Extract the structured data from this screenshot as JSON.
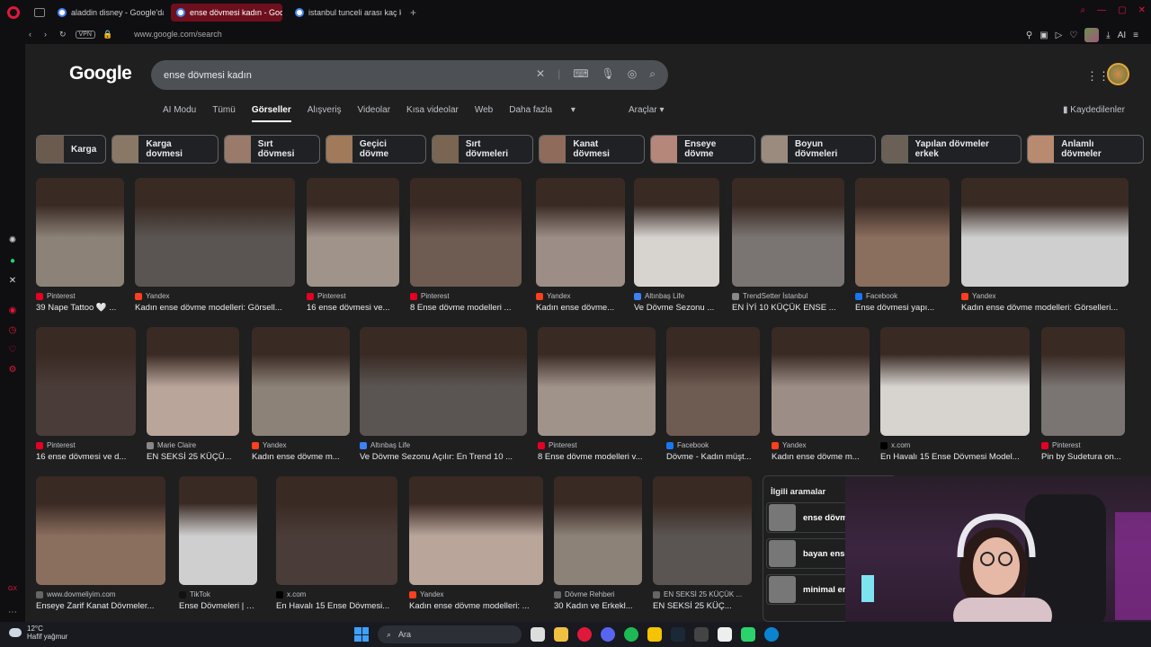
{
  "browser": {
    "tabs": [
      {
        "label": "aladdin disney - Google'da",
        "active": false
      },
      {
        "label": "ense dövmesi kadın - Goo",
        "active": true
      },
      {
        "label": "istanbul tunceli arası kaç k",
        "active": false
      }
    ],
    "new_tab_label": "+",
    "vpn_label": "VPN",
    "url": "www.google.com/search",
    "ai_label": "AI"
  },
  "google": {
    "logo": "Google",
    "query": "ense dövmesi kadın",
    "tabs": [
      "AI Modu",
      "Tümü",
      "Görseller",
      "Alışveriş",
      "Videolar",
      "Kısa videolar",
      "Web",
      "Daha fazla"
    ],
    "selected_tab": "Görseller",
    "tools_label": "Araçlar",
    "saved_label": "Kaydedilenler"
  },
  "chips": [
    "Karga",
    "Karga dovmesi",
    "Sırt dövmesi",
    "Geçici dövme",
    "Sırt dövmeleri",
    "Kanat dövmesi",
    "Enseye dövme",
    "Boyun dövmeleri",
    "Yapılan dövmeler erkek",
    "Anlamlı dövmeler"
  ],
  "results_row1": [
    {
      "source": "Pinterest",
      "title": "39 Nape Tattoo 🤍 ...",
      "src_color": "#e60023"
    },
    {
      "source": "Yandex",
      "title": "Kadın ense dövme modelleri: Görsell...",
      "src_color": "#fc3f1d"
    },
    {
      "source": "Pinterest",
      "title": "16 ense dövmesi ve...",
      "src_color": "#e60023"
    },
    {
      "source": "Pinterest",
      "title": "8 Ense dövme modelleri ...",
      "src_color": "#e60023"
    },
    {
      "source": "Yandex",
      "title": "Kadın ense dövme...",
      "src_color": "#fc3f1d"
    },
    {
      "source": "Altınbaş Life",
      "title": "Ve Dövme Sezonu ...",
      "src_color": "#3b82f6"
    },
    {
      "source": "TrendSetter İstanbul",
      "title": "EN İYİ 10 KÜÇÜK ENSE ...",
      "src_color": "#888888"
    },
    {
      "source": "Facebook",
      "title": "Ense dövmesi yapı...",
      "src_color": "#1877f2"
    },
    {
      "source": "Yandex",
      "title": "Kadın ense dövme modelleri: Görselleri...",
      "src_color": "#fc3f1d"
    }
  ],
  "results_row2": [
    {
      "source": "Pinterest",
      "title": "16 ense dövmesi ve d...",
      "src_color": "#e60023"
    },
    {
      "source": "Marie Claire",
      "title": "EN SEKSİ 25 KÜÇÜ...",
      "src_color": "#888888"
    },
    {
      "source": "Yandex",
      "title": "Kadın ense dövme m...",
      "src_color": "#fc3f1d"
    },
    {
      "source": "Altınbaş Life",
      "title": "Ve Dövme Sezonu Açılır: En Trend 10 ...",
      "src_color": "#3b82f6"
    },
    {
      "source": "Pinterest",
      "title": "8 Ense dövme modelleri v...",
      "src_color": "#e60023"
    },
    {
      "source": "Facebook",
      "title": "Dövme - Kadın müşt...",
      "src_color": "#1877f2"
    },
    {
      "source": "Yandex",
      "title": "Kadın ense dövme m...",
      "src_color": "#fc3f1d"
    },
    {
      "source": "x.com",
      "title": "En Havalı 15 Ense Dövmesi Model...",
      "src_color": "#000000"
    },
    {
      "source": "Pinterest",
      "title": "Pin by Sudetura on...",
      "src_color": "#e60023"
    }
  ],
  "results_row3": [
    {
      "source": "www.dovmeliyim.com",
      "title": "Enseye Zarif Kanat Dövmeler...",
      "src_color": "#666666"
    },
    {
      "source": "TikTok",
      "title": "Ense Dövmeleri | T...",
      "src_color": "#111111"
    },
    {
      "source": "x.com",
      "title": "En Havalı 15 Ense Dövmesi...",
      "src_color": "#000000"
    },
    {
      "source": "Yandex",
      "title": "Kadın ense dövme modelleri: ...",
      "src_color": "#fc3f1d"
    },
    {
      "source": "Dövme Rehberi",
      "title": "30 Kadın ve Erkekl...",
      "src_color": "#666666"
    },
    {
      "source": "EN SEKSİ 25 KÜÇÜK ...",
      "title": "EN SEKSİ 25 KÜÇ...",
      "src_color": "#666666"
    }
  ],
  "related": {
    "title": "İlgili aramalar",
    "items": [
      "ense dövme",
      "bayan ense",
      "minimal en"
    ]
  },
  "taskbar": {
    "temperature": "12°C",
    "weather": "Hafif yağmur",
    "search_label": "Ara"
  }
}
